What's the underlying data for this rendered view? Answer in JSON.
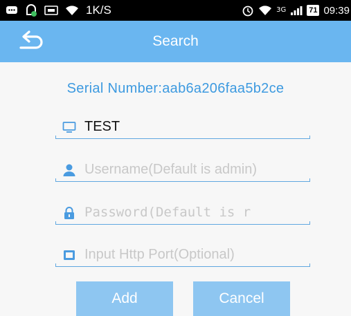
{
  "status_bar": {
    "net_speed": "1K/S",
    "network_type": "3G",
    "battery": "71",
    "time": "09:39"
  },
  "header": {
    "title": "Search",
    "back_icon": "back-arrow-icon"
  },
  "serial_number": "Serial Number:aab6a206faa5b2ce",
  "fields": {
    "device_name": {
      "value": "TEST",
      "placeholder": "",
      "icon": "monitor-icon"
    },
    "username": {
      "value": "",
      "placeholder": "Username(Default is admin)",
      "icon": "user-icon"
    },
    "password": {
      "value": "",
      "placeholder": "Password(Default is r",
      "icon": "lock-icon"
    },
    "http_port": {
      "value": "",
      "placeholder": "Input Http Port(Optional)",
      "icon": "port-icon"
    }
  },
  "buttons": {
    "add": "Add",
    "cancel": "Cancel"
  },
  "colors": {
    "header": "#6ab6f0",
    "accent": "#3d9ae0",
    "button": "#8ec6f1"
  }
}
